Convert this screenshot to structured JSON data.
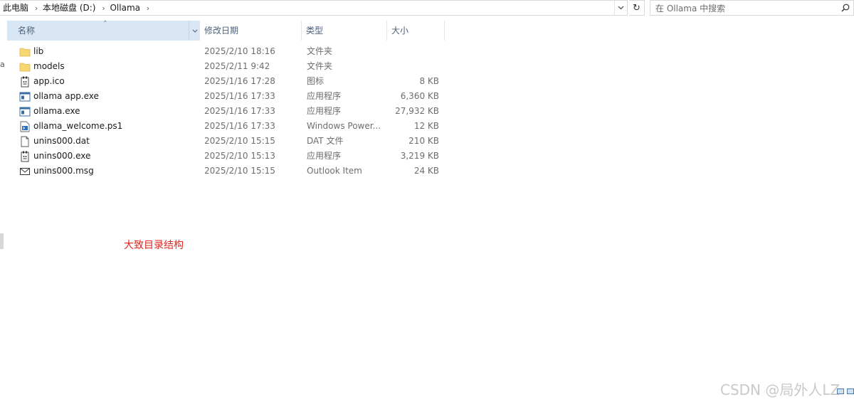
{
  "address_bar": {
    "crumbs": [
      "此电脑",
      "本地磁盘 (D:)",
      "Ollama"
    ]
  },
  "search": {
    "placeholder": "在 Ollama 中搜索"
  },
  "nav_remnant": "a",
  "columns": {
    "name": "名称",
    "date": "修改日期",
    "type": "类型",
    "size": "大小"
  },
  "files": [
    {
      "name": "lib",
      "date": "2025/2/10 18:16",
      "type": "文件夹",
      "size": "",
      "icon": "folder-icon"
    },
    {
      "name": "models",
      "date": "2025/2/11 9:42",
      "type": "文件夹",
      "size": "",
      "icon": "folder-icon"
    },
    {
      "name": "app.ico",
      "date": "2025/1/16 17:28",
      "type": "图标",
      "size": "8 KB",
      "icon": "ico-file-icon"
    },
    {
      "name": "ollama app.exe",
      "date": "2025/1/16 17:33",
      "type": "应用程序",
      "size": "6,360 KB",
      "icon": "app-window-icon"
    },
    {
      "name": "ollama.exe",
      "date": "2025/1/16 17:33",
      "type": "应用程序",
      "size": "27,932 KB",
      "icon": "app-window-icon"
    },
    {
      "name": "ollama_welcome.ps1",
      "date": "2025/1/16 17:33",
      "type": "Windows Power...",
      "size": "12 KB",
      "icon": "powershell-script-icon"
    },
    {
      "name": "unins000.dat",
      "date": "2025/2/10 15:15",
      "type": "DAT 文件",
      "size": "210 KB",
      "icon": "blank-file-icon"
    },
    {
      "name": "unins000.exe",
      "date": "2025/2/10 15:13",
      "type": "应用程序",
      "size": "3,219 KB",
      "icon": "ico-file-icon"
    },
    {
      "name": "unins000.msg",
      "date": "2025/2/10 15:15",
      "type": "Outlook Item",
      "size": "24 KB",
      "icon": "envelope-icon"
    }
  ],
  "annotation": "大致目录结构",
  "watermark": "CSDN @局外人LZ"
}
